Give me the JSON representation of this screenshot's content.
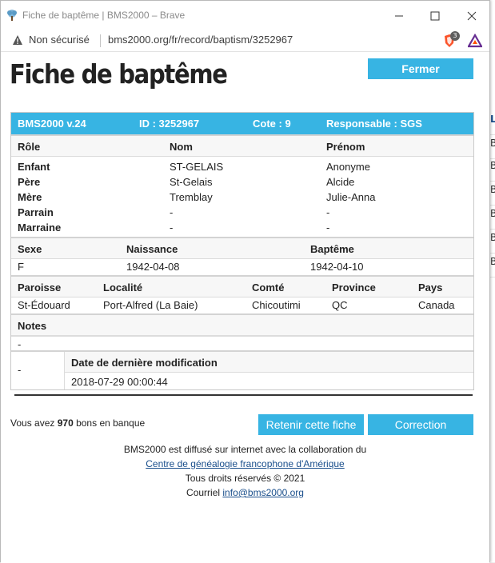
{
  "browser": {
    "window_title": "Fiche de baptême | BMS2000 – Brave",
    "security_label": "Non sécurisé",
    "url": "bms2000.org/fr/record/baptism/3252967",
    "shield_count": "3"
  },
  "page": {
    "title": "Fiche de baptême",
    "close_button": "Fermer",
    "record": {
      "header": {
        "version": "BMS2000 v.24",
        "id": "ID : 3252967",
        "cote": "Cote : 9",
        "responsable": "Responsable : SGS"
      },
      "persons_headers": [
        "Rôle",
        "Nom",
        "Prénom"
      ],
      "persons": [
        {
          "role": "Enfant",
          "nom": "ST-GELAIS",
          "prenom": "Anonyme"
        },
        {
          "role": "Père",
          "nom": "St-Gelais",
          "prenom": "Alcide"
        },
        {
          "role": "Mère",
          "nom": "Tremblay",
          "prenom": "Julie-Anna"
        },
        {
          "role": "Parrain",
          "nom": "-",
          "prenom": "-"
        },
        {
          "role": "Marraine",
          "nom": "-",
          "prenom": "-"
        }
      ],
      "dates_headers": [
        "Sexe",
        "Naissance",
        "Baptême"
      ],
      "dates": {
        "sexe": "F",
        "naissance": "1942-04-08",
        "bapteme": "1942-04-10"
      },
      "place_headers": [
        "Paroisse",
        "Localité",
        "Comté",
        "Province",
        "Pays"
      ],
      "place": {
        "paroisse": "St-Édouard",
        "localite": "Port-Alfred (La Baie)",
        "comte": "Chicoutimi",
        "province": "QC",
        "pays": "Canada"
      },
      "notes_label": "Notes",
      "notes_value": "-",
      "modif_left": "-",
      "modif_label": "Date de dernière modification",
      "modif_value": "2018-07-29 00:00:44"
    },
    "bank": {
      "prefix": "Vous avez ",
      "count": "970",
      "suffix": " bons en banque"
    },
    "keep_button": "Retenir cette fiche",
    "correct_button": "Correction",
    "footer": {
      "line1": "BMS2000 est diffusé sur internet avec la collaboration du",
      "link1": "Centre de généalogie francophone d'Amérique",
      "line3": "Tous droits réservés © 2021",
      "email_prefix": "Courriel ",
      "email": "info@bms2000.org"
    }
  },
  "background_strip": {
    "cells": [
      "Lo",
      "Ba",
      "Ba",
      "Ba",
      "Ba",
      "Ba",
      "Ba"
    ]
  },
  "colors": {
    "accent": "#37b4e3",
    "link": "#1a4f8c"
  }
}
